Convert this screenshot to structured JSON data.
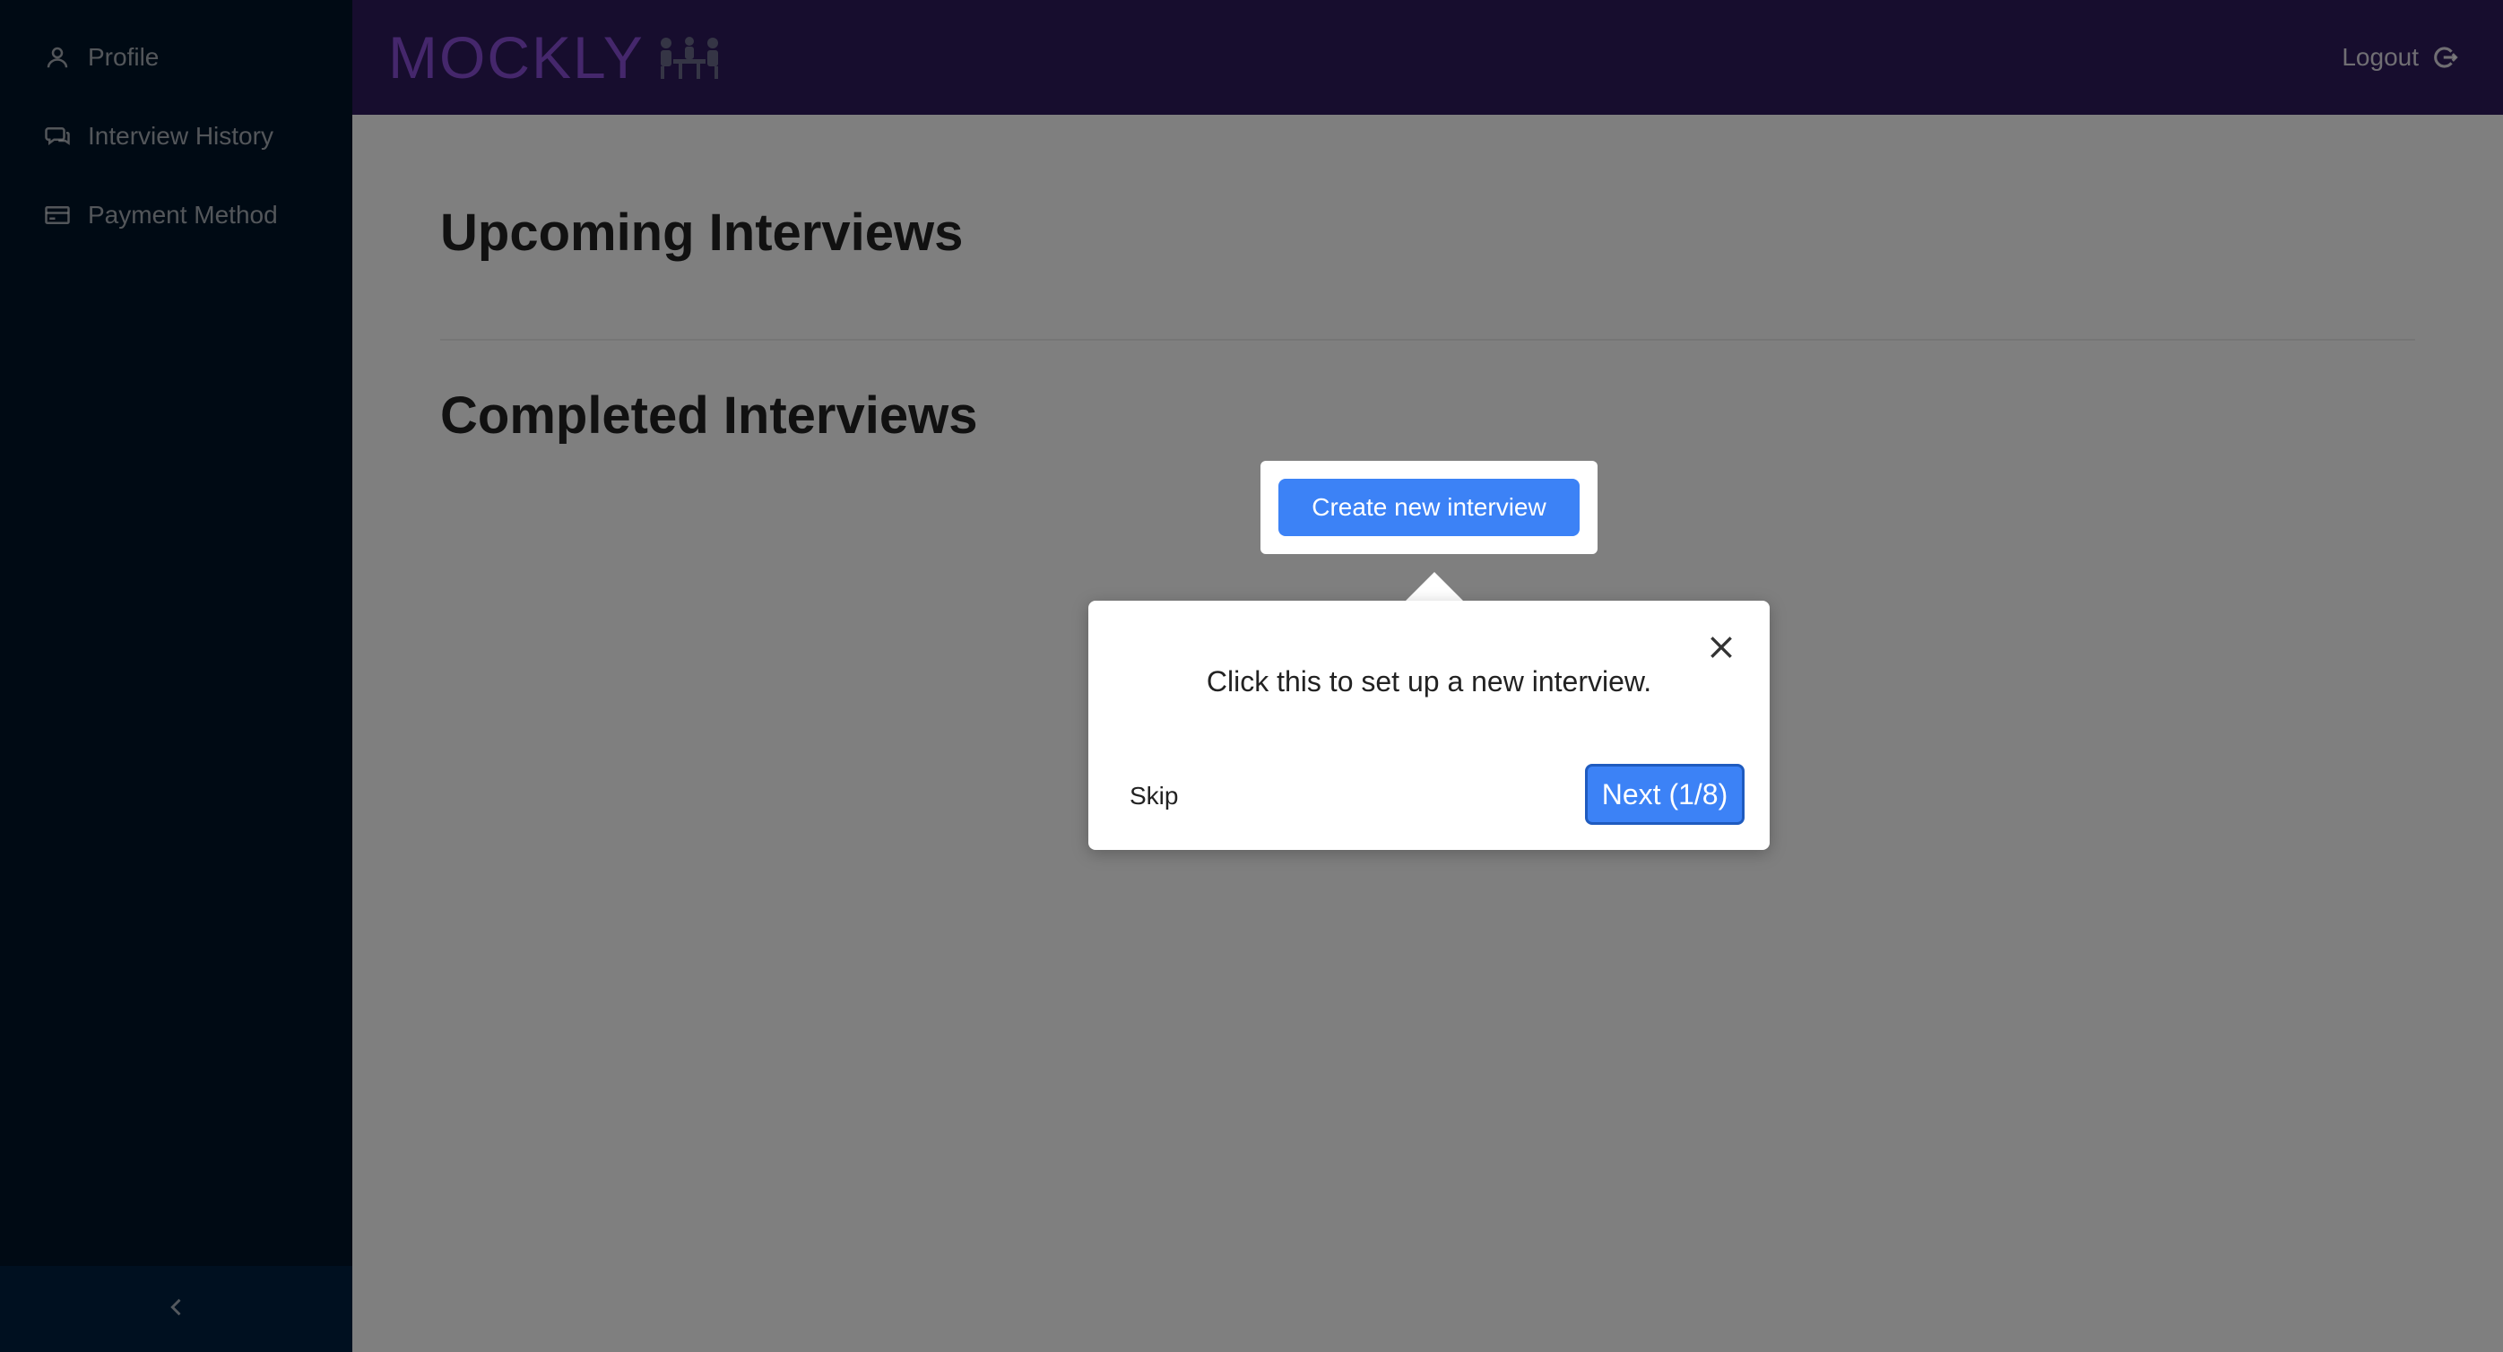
{
  "sidebar": {
    "items": [
      {
        "label": "Profile",
        "icon": "user-icon"
      },
      {
        "label": "Interview History",
        "icon": "chat-icon"
      },
      {
        "label": "Payment Method",
        "icon": "credit-card-icon"
      }
    ]
  },
  "header": {
    "logo_text": "MOCKLY",
    "logout_label": "Logout"
  },
  "main": {
    "upcoming_title": "Upcoming Interviews",
    "completed_title": "Completed Interviews",
    "create_button_label": "Create new interview"
  },
  "tour": {
    "message": "Click this to set up a new interview.",
    "skip_label": "Skip",
    "next_label": "Next (1/8)"
  },
  "colors": {
    "sidebar_bg": "#001529",
    "header_bg": "#2f1b5c",
    "logo": "#8a4fd8",
    "primary": "#3c82f6"
  }
}
